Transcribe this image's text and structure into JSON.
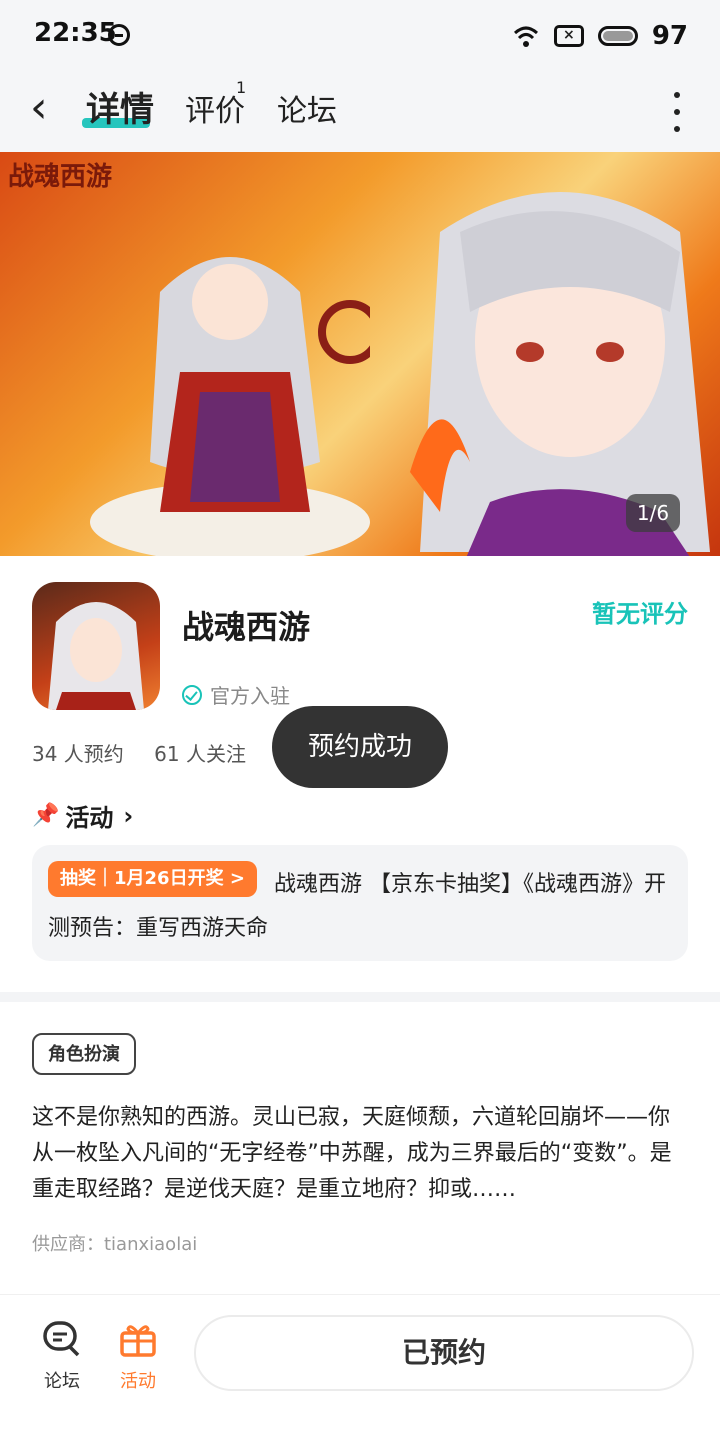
{
  "status_bar": {
    "time": "22:35",
    "battery": "97"
  },
  "nav": {
    "tabs": [
      {
        "label": "详情",
        "active": true
      },
      {
        "label": "评价",
        "badge": "1"
      },
      {
        "label": "论坛"
      }
    ]
  },
  "banner": {
    "logo_text": "战魂西游",
    "counter": "1/6"
  },
  "app": {
    "name": "战魂西游",
    "rating_status": "暂无评分",
    "official_label": "官方入驻",
    "reservations": "34 人预约",
    "followers": "61 人关注"
  },
  "toast": "预约成功",
  "activity": {
    "header": "活动",
    "tag": "抽奖｜1月26日开奖 >",
    "text": "战魂西游 【京东卡抽奖】《战魂西游》开测预告：重写西游天命"
  },
  "details": {
    "genre": "角色扮演",
    "description": "这不是你熟知的西游。灵山已寂，天庭倾颓，六道轮回崩坏——你从一枚坠入凡间的“无字经卷”中苏醒，成为三界最后的“变数”。是重走取经路？是逆伐天庭？是重立地府？抑或……",
    "supplier": "供应商：tianxiaolai"
  },
  "bottom_bar": {
    "forum_label": "论坛",
    "activity_label": "活动",
    "reserve_button": "已预约"
  },
  "colors": {
    "accent": "#19c3b8",
    "orange": "#ff7a2e"
  }
}
